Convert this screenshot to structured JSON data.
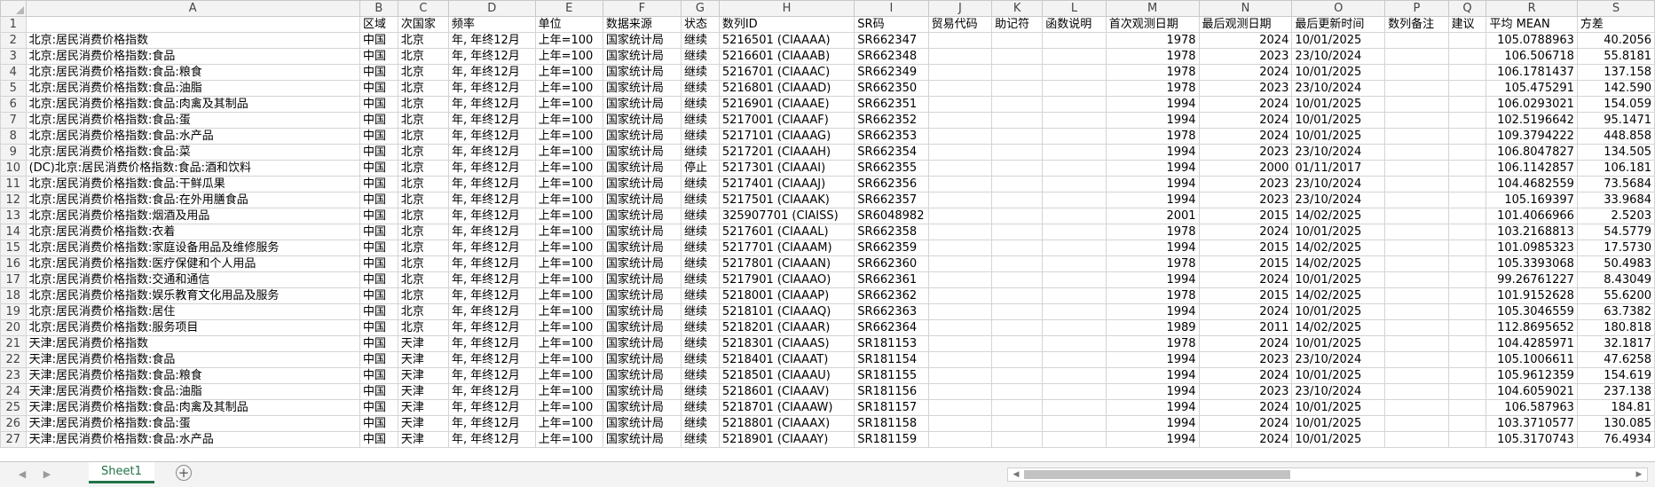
{
  "columns": [
    "A",
    "B",
    "C",
    "D",
    "E",
    "F",
    "G",
    "H",
    "I",
    "J",
    "K",
    "L",
    "M",
    "N",
    "O",
    "P",
    "Q",
    "R",
    "S"
  ],
  "header_row": [
    "",
    "区域",
    "次国家",
    "频率",
    "单位",
    "数据来源",
    "状态",
    "数列ID",
    "SR码",
    "贸易代码",
    "助记符",
    "函数说明",
    "首次观测日期",
    "最后观测日期",
    "最后更新时间",
    "数列备注",
    "建议",
    "平均 MEAN",
    "方差"
  ],
  "rows": [
    [
      "北京:居民消费价格指数",
      "中国",
      "北京",
      "年, 年终12月",
      "上年=100",
      "国家统计局",
      "继续",
      "5216501 (CIAAAA)",
      "SR662347",
      "",
      "",
      "",
      "1978",
      "2024",
      "10/01/2025",
      "",
      "",
      "105.0788963",
      "40.2056"
    ],
    [
      "北京:居民消费价格指数:食品",
      "中国",
      "北京",
      "年, 年终12月",
      "上年=100",
      "国家统计局",
      "继续",
      "5216601 (CIAAAB)",
      "SR662348",
      "",
      "",
      "",
      "1978",
      "2023",
      "23/10/2024",
      "",
      "",
      "106.506718",
      "55.8181"
    ],
    [
      "北京:居民消费价格指数:食品:粮食",
      "中国",
      "北京",
      "年, 年终12月",
      "上年=100",
      "国家统计局",
      "继续",
      "5216701 (CIAAAC)",
      "SR662349",
      "",
      "",
      "",
      "1978",
      "2024",
      "10/01/2025",
      "",
      "",
      "106.1781437",
      "137.158"
    ],
    [
      "北京:居民消费价格指数:食品:油脂",
      "中国",
      "北京",
      "年, 年终12月",
      "上年=100",
      "国家统计局",
      "继续",
      "5216801 (CIAAAD)",
      "SR662350",
      "",
      "",
      "",
      "1978",
      "2023",
      "23/10/2024",
      "",
      "",
      "105.475291",
      "142.590"
    ],
    [
      "北京:居民消费价格指数:食品:肉禽及其制品",
      "中国",
      "北京",
      "年, 年终12月",
      "上年=100",
      "国家统计局",
      "继续",
      "5216901 (CIAAAE)",
      "SR662351",
      "",
      "",
      "",
      "1994",
      "2024",
      "10/01/2025",
      "",
      "",
      "106.0293021",
      "154.059"
    ],
    [
      "北京:居民消费价格指数:食品:蛋",
      "中国",
      "北京",
      "年, 年终12月",
      "上年=100",
      "国家统计局",
      "继续",
      "5217001 (CIAAAF)",
      "SR662352",
      "",
      "",
      "",
      "1994",
      "2024",
      "10/01/2025",
      "",
      "",
      "102.5196642",
      "95.1471"
    ],
    [
      "北京:居民消费价格指数:食品:水产品",
      "中国",
      "北京",
      "年, 年终12月",
      "上年=100",
      "国家统计局",
      "继续",
      "5217101 (CIAAAG)",
      "SR662353",
      "",
      "",
      "",
      "1978",
      "2024",
      "10/01/2025",
      "",
      "",
      "109.3794222",
      "448.858"
    ],
    [
      "北京:居民消费价格指数:食品:菜",
      "中国",
      "北京",
      "年, 年终12月",
      "上年=100",
      "国家统计局",
      "继续",
      "5217201 (CIAAAH)",
      "SR662354",
      "",
      "",
      "",
      "1994",
      "2023",
      "23/10/2024",
      "",
      "",
      "106.8047827",
      "134.505"
    ],
    [
      "(DC)北京:居民消费价格指数:食品:酒和饮料",
      "中国",
      "北京",
      "年, 年终12月",
      "上年=100",
      "国家统计局",
      "停止",
      "5217301 (CIAAAI)",
      "SR662355",
      "",
      "",
      "",
      "1994",
      "2000",
      "01/11/2017",
      "",
      "",
      "106.1142857",
      "106.181"
    ],
    [
      "北京:居民消费价格指数:食品:干鲜瓜果",
      "中国",
      "北京",
      "年, 年终12月",
      "上年=100",
      "国家统计局",
      "继续",
      "5217401 (CIAAAJ)",
      "SR662356",
      "",
      "",
      "",
      "1994",
      "2023",
      "23/10/2024",
      "",
      "",
      "104.4682559",
      "73.5684"
    ],
    [
      "北京:居民消费价格指数:食品:在外用膳食品",
      "中国",
      "北京",
      "年, 年终12月",
      "上年=100",
      "国家统计局",
      "继续",
      "5217501 (CIAAAK)",
      "SR662357",
      "",
      "",
      "",
      "1994",
      "2023",
      "23/10/2024",
      "",
      "",
      "105.169397",
      "33.9684"
    ],
    [
      "北京:居民消费价格指数:烟酒及用品",
      "中国",
      "北京",
      "年, 年终12月",
      "上年=100",
      "国家统计局",
      "继续",
      "325907701 (CIAISS)",
      "SR6048982",
      "",
      "",
      "",
      "2001",
      "2015",
      "14/02/2025",
      "",
      "",
      "101.4066966",
      "2.5203"
    ],
    [
      "北京:居民消费价格指数:衣着",
      "中国",
      "北京",
      "年, 年终12月",
      "上年=100",
      "国家统计局",
      "继续",
      "5217601 (CIAAAL)",
      "SR662358",
      "",
      "",
      "",
      "1978",
      "2024",
      "10/01/2025",
      "",
      "",
      "103.2168813",
      "54.5779"
    ],
    [
      "北京:居民消费价格指数:家庭设备用品及维修服务",
      "中国",
      "北京",
      "年, 年终12月",
      "上年=100",
      "国家统计局",
      "继续",
      "5217701 (CIAAAM)",
      "SR662359",
      "",
      "",
      "",
      "1994",
      "2015",
      "14/02/2025",
      "",
      "",
      "101.0985323",
      "17.5730"
    ],
    [
      "北京:居民消费价格指数:医疗保健和个人用品",
      "中国",
      "北京",
      "年, 年终12月",
      "上年=100",
      "国家统计局",
      "继续",
      "5217801 (CIAAAN)",
      "SR662360",
      "",
      "",
      "",
      "1978",
      "2015",
      "14/02/2025",
      "",
      "",
      "105.3393068",
      "50.4983"
    ],
    [
      "北京:居民消费价格指数:交通和通信",
      "中国",
      "北京",
      "年, 年终12月",
      "上年=100",
      "国家统计局",
      "继续",
      "5217901 (CIAAAO)",
      "SR662361",
      "",
      "",
      "",
      "1994",
      "2024",
      "10/01/2025",
      "",
      "",
      "99.26761227",
      "8.43049"
    ],
    [
      "北京:居民消费价格指数:娱乐教育文化用品及服务",
      "中国",
      "北京",
      "年, 年终12月",
      "上年=100",
      "国家统计局",
      "继续",
      "5218001 (CIAAAP)",
      "SR662362",
      "",
      "",
      "",
      "1978",
      "2015",
      "14/02/2025",
      "",
      "",
      "101.9152628",
      "55.6200"
    ],
    [
      "北京:居民消费价格指数:居住",
      "中国",
      "北京",
      "年, 年终12月",
      "上年=100",
      "国家统计局",
      "继续",
      "5218101 (CIAAAQ)",
      "SR662363",
      "",
      "",
      "",
      "1994",
      "2024",
      "10/01/2025",
      "",
      "",
      "105.3046559",
      "63.7382"
    ],
    [
      "北京:居民消费价格指数:服务项目",
      "中国",
      "北京",
      "年, 年终12月",
      "上年=100",
      "国家统计局",
      "继续",
      "5218201 (CIAAAR)",
      "SR662364",
      "",
      "",
      "",
      "1989",
      "2011",
      "14/02/2025",
      "",
      "",
      "112.8695652",
      "180.818"
    ],
    [
      "天津:居民消费价格指数",
      "中国",
      "天津",
      "年, 年终12月",
      "上年=100",
      "国家统计局",
      "继续",
      "5218301 (CIAAAS)",
      "SR181153",
      "",
      "",
      "",
      "1978",
      "2024",
      "10/01/2025",
      "",
      "",
      "104.4285971",
      "32.1817"
    ],
    [
      "天津:居民消费价格指数:食品",
      "中国",
      "天津",
      "年, 年终12月",
      "上年=100",
      "国家统计局",
      "继续",
      "5218401 (CIAAAT)",
      "SR181154",
      "",
      "",
      "",
      "1994",
      "2023",
      "23/10/2024",
      "",
      "",
      "105.1006611",
      "47.6258"
    ],
    [
      "天津:居民消费价格指数:食品:粮食",
      "中国",
      "天津",
      "年, 年终12月",
      "上年=100",
      "国家统计局",
      "继续",
      "5218501 (CIAAAU)",
      "SR181155",
      "",
      "",
      "",
      "1994",
      "2024",
      "10/01/2025",
      "",
      "",
      "105.9612359",
      "154.619"
    ],
    [
      "天津:居民消费价格指数:食品:油脂",
      "中国",
      "天津",
      "年, 年终12月",
      "上年=100",
      "国家统计局",
      "继续",
      "5218601 (CIAAAV)",
      "SR181156",
      "",
      "",
      "",
      "1994",
      "2023",
      "23/10/2024",
      "",
      "",
      "104.6059021",
      "237.138"
    ],
    [
      "天津:居民消费价格指数:食品:肉禽及其制品",
      "中国",
      "天津",
      "年, 年终12月",
      "上年=100",
      "国家统计局",
      "继续",
      "5218701 (CIAAAW)",
      "SR181157",
      "",
      "",
      "",
      "1994",
      "2024",
      "10/01/2025",
      "",
      "",
      "106.587963",
      "184.81"
    ],
    [
      "天津:居民消费价格指数:食品:蛋",
      "中国",
      "天津",
      "年, 年终12月",
      "上年=100",
      "国家统计局",
      "继续",
      "5218801 (CIAAAX)",
      "SR181158",
      "",
      "",
      "",
      "1994",
      "2024",
      "10/01/2025",
      "",
      "",
      "103.3710577",
      "130.085"
    ],
    [
      "天津:居民消费价格指数:食品:水产品",
      "中国",
      "天津",
      "年, 年终12月",
      "上年=100",
      "国家统计局",
      "继续",
      "5218901 (CIAAAY)",
      "SR181159",
      "",
      "",
      "",
      "1994",
      "2024",
      "10/01/2025",
      "",
      "",
      "105.3170743",
      "76.4934"
    ]
  ],
  "sheet_tabs": [
    "Sheet1"
  ],
  "add_sheet_symbol": "+",
  "icons": {
    "corner": "select-all-icon",
    "nav_prev": "nav-prev-icon",
    "nav_next": "nav-next-icon",
    "add": "add-sheet-icon"
  },
  "colors": {
    "accent": "#217346",
    "header_bg": "#f3f3f3",
    "gridline": "#d4d4d4"
  }
}
